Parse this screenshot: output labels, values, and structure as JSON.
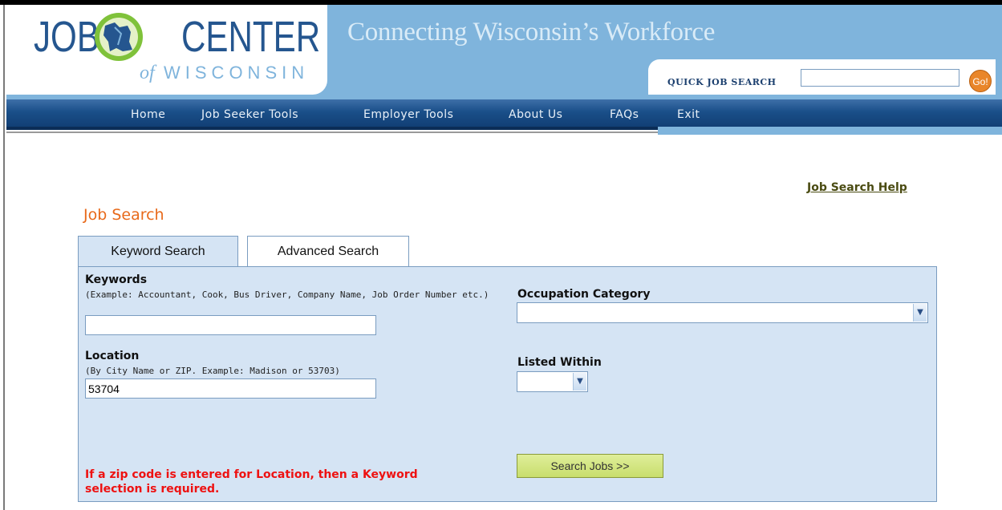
{
  "header": {
    "logo_job": "JOB",
    "logo_center": "CENTER",
    "logo_of": "of",
    "logo_wisconsin": "WISCONSIN",
    "tagline": "Connecting Wisconsin’s Workforce",
    "quick_search_label": "QUICK JOB SEARCH",
    "quick_search_value": "",
    "go_label": "Go!"
  },
  "nav": {
    "items": [
      "Home",
      "Job Seeker Tools",
      "Employer Tools",
      "About Us",
      "FAQs",
      "Exit"
    ]
  },
  "help_link": "Job Search Help",
  "page_title": "Job Search",
  "tabs": {
    "keyword": "Keyword Search",
    "advanced": "Advanced Search",
    "active": "keyword"
  },
  "form": {
    "keywords_label": "Keywords",
    "keywords_hint": "(Example: Accountant, Cook, Bus Driver, Company Name, Job Order Number etc.)",
    "keywords_value": "",
    "location_label": "Location",
    "location_hint": "(By City Name or ZIP. Example: Madison or 53703)",
    "location_value": "53704",
    "occupation_label": "Occupation Category",
    "occupation_value": "",
    "listed_label": "Listed Within",
    "listed_value": "",
    "search_button": "Search Jobs >>",
    "warning": "If a zip code is entered for Location, then a Keyword selection is required."
  },
  "colors": {
    "header_blue": "#7fb4dc",
    "nav_blue": "#1a4f89",
    "panel_bg": "#d5e4f4",
    "title_orange": "#e86a1b",
    "warning_red": "#ee1111",
    "button_green": "#c8de6c"
  }
}
